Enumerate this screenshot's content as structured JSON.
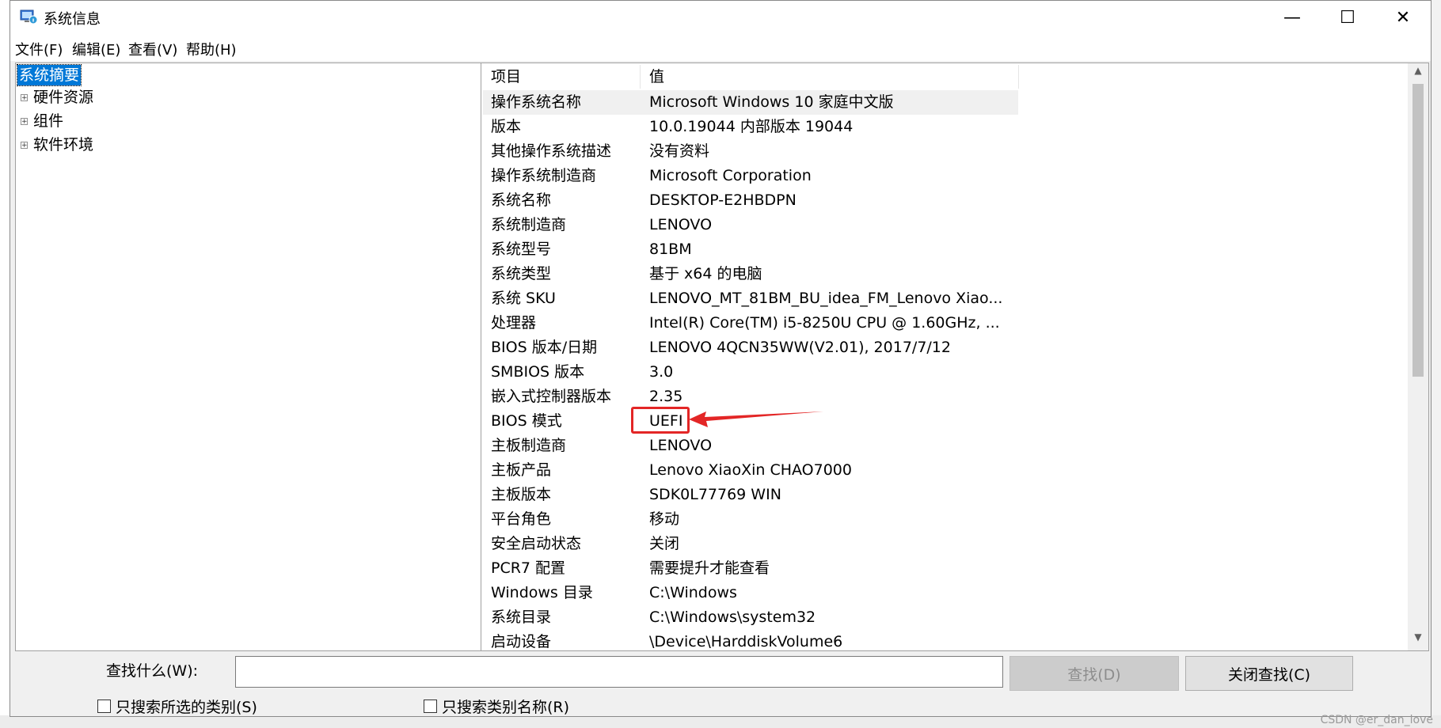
{
  "window": {
    "title": "系统信息",
    "controls": {
      "minimize": "—",
      "maximize": "☐",
      "close": "✕"
    }
  },
  "menu": [
    {
      "label": "文件(F)"
    },
    {
      "label": "编辑(E)"
    },
    {
      "label": "查看(V)"
    },
    {
      "label": "帮助(H)"
    }
  ],
  "tree": {
    "selected": "系统摘要",
    "items": [
      {
        "label": "硬件资源"
      },
      {
        "label": "组件"
      },
      {
        "label": "软件环境"
      }
    ],
    "expander": "+"
  },
  "table": {
    "headers": {
      "item": "项目",
      "value": "值"
    },
    "rows": [
      {
        "name": "操作系统名称",
        "value": "Microsoft Windows 10 家庭中文版"
      },
      {
        "name": "版本",
        "value": "10.0.19044 内部版本 19044"
      },
      {
        "name": "其他操作系统描述",
        "value": "没有资料"
      },
      {
        "name": "操作系统制造商",
        "value": "Microsoft Corporation"
      },
      {
        "name": "系统名称",
        "value": "DESKTOP-E2HBDPN"
      },
      {
        "name": "系统制造商",
        "value": "LENOVO"
      },
      {
        "name": "系统型号",
        "value": "81BM"
      },
      {
        "name": "系统类型",
        "value": "基于 x64 的电脑"
      },
      {
        "name": "系统 SKU",
        "value": "LENOVO_MT_81BM_BU_idea_FM_Lenovo Xiao..."
      },
      {
        "name": "处理器",
        "value": "Intel(R) Core(TM) i5-8250U CPU @ 1.60GHz, ..."
      },
      {
        "name": "BIOS 版本/日期",
        "value": "LENOVO 4QCN35WW(V2.01), 2017/7/12"
      },
      {
        "name": "SMBIOS 版本",
        "value": "3.0"
      },
      {
        "name": "嵌入式控制器版本",
        "value": "2.35"
      },
      {
        "name": "BIOS 模式",
        "value": "UEFI"
      },
      {
        "name": "主板制造商",
        "value": "LENOVO"
      },
      {
        "name": "主板产品",
        "value": "Lenovo XiaoXin CHAO7000"
      },
      {
        "name": "主板版本",
        "value": "SDK0L77769 WIN"
      },
      {
        "name": "平台角色",
        "value": "移动"
      },
      {
        "name": "安全启动状态",
        "value": "关闭"
      },
      {
        "name": "PCR7 配置",
        "value": "需要提升才能查看"
      },
      {
        "name": "Windows 目录",
        "value": "C:\\Windows"
      },
      {
        "name": "系统目录",
        "value": "C:\\Windows\\system32"
      },
      {
        "name": "启动设备",
        "value": "\\Device\\HarddiskVolume6"
      }
    ]
  },
  "scrollbar": {
    "up": "▲",
    "down": "▼"
  },
  "search": {
    "label": "查找什么(W):",
    "value": "",
    "find_button": "查找(D)",
    "close_find_button": "关闭查找(C)",
    "option_selected_only": "只搜索所选的类别(S)",
    "option_category_names": "只搜索类别名称(R)"
  },
  "watermark": "CSDN @er_dan_love",
  "colors": {
    "selection": "#0078d7",
    "annotation": "#e32626"
  }
}
